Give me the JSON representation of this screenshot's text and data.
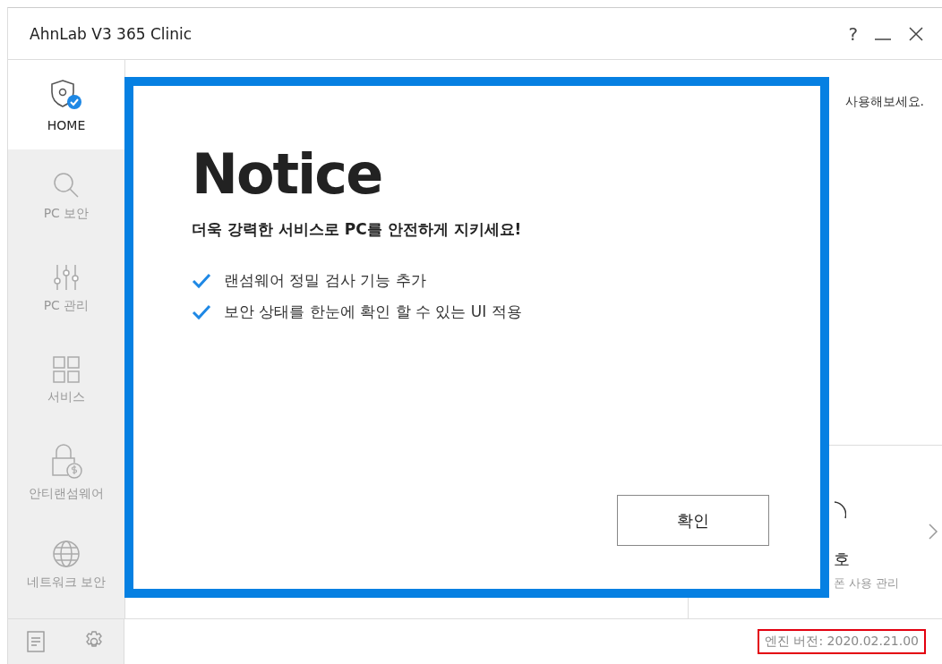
{
  "window": {
    "title": "AhnLab V3 365 Clinic",
    "controls": [
      "?"
    ]
  },
  "sidebar": {
    "items": [
      {
        "label": "HOME",
        "selected": true
      },
      {
        "label": "PC 보안",
        "selected": false
      },
      {
        "label": "PC 관리",
        "selected": false
      },
      {
        "label": "서비스",
        "selected": false
      },
      {
        "label": "안티랜섬웨어",
        "selected": false
      },
      {
        "label": "네트워크 보안",
        "selected": false
      }
    ]
  },
  "background": {
    "hint": "사용해보세요.",
    "card": {
      "title": "호",
      "subtitle": "폰 사용 관리"
    }
  },
  "notice": {
    "heading": "Notice",
    "subtitle": "더욱 강력한 서비스로 PC를 안전하게 지키세요!",
    "items": [
      "랜섬웨어 정밀 검사 기능 추가",
      "보안 상태를 한눈에 확인 할 수 있는 UI 적용"
    ],
    "button": "확인"
  },
  "status_bar": {
    "engine_version": "엔진 버전: 2020.02.21.00"
  }
}
